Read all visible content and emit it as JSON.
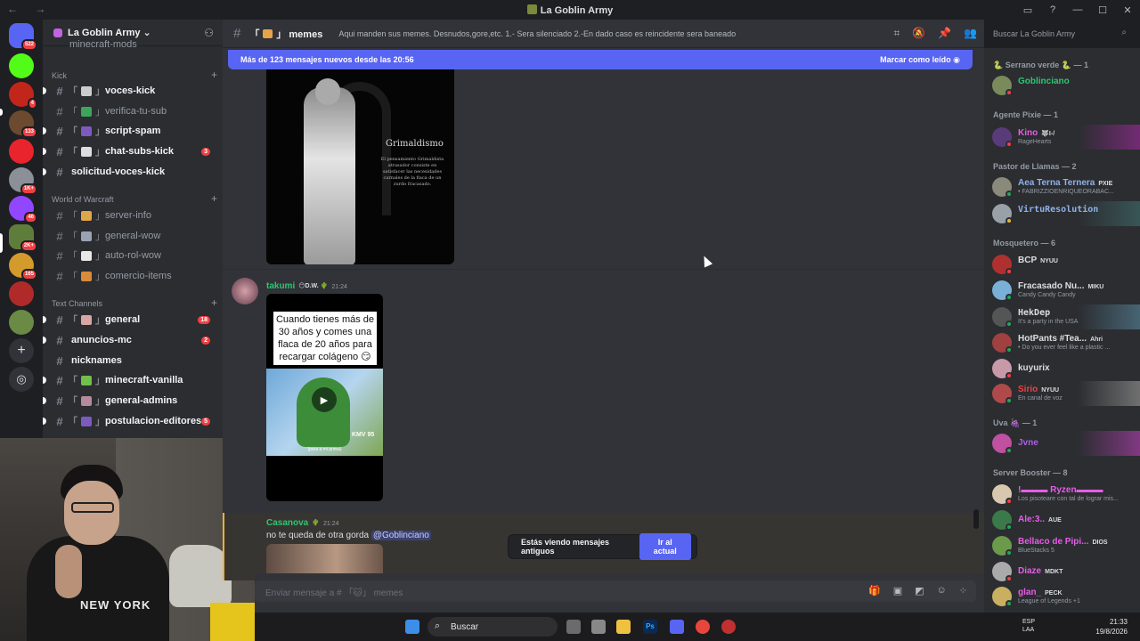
{
  "window": {
    "title": "La Goblin Army",
    "nav_arrows": "← →"
  },
  "servers": {
    "badges": [
      "522",
      "4",
      "133",
      "1K+",
      "46",
      "2K+",
      "165"
    ],
    "labels": {
      "s3": "4",
      "s4": "133",
      "s6": "1K+",
      "s7": "46",
      "s8": "2K+",
      "s9": "165",
      "s1": "522"
    }
  },
  "guild": {
    "name": "La Goblin Army ⌄"
  },
  "channels": {
    "top_partial": "minecraft-mods",
    "cat_kick": "Kick",
    "voces_kick": "voces-kick",
    "verifica": "verifica-tu-sub",
    "script_spam": "script-spam",
    "chat_subs": "chat-subs-kick",
    "chat_subs_badge": "3",
    "solicitud": "solicitud-voces-kick",
    "cat_wow": "World of Warcraft",
    "server_info": "server-info",
    "general_wow": "general-wow",
    "auto_rol": "auto-rol-wow",
    "comercio": "comercio-items",
    "cat_text": "Text Channels",
    "general": "general",
    "general_badge": "18",
    "anuncios": "anuncios-mc",
    "anuncios_badge": "2",
    "nicknames": "nicknames",
    "minecraft_vanilla": "minecraft-vanilla",
    "general_admins": "general-admins",
    "postulacion": "postulacion-editores",
    "postulacion_badge": "5"
  },
  "header": {
    "channel": "memes",
    "topic": "Aqui manden sus memes. Desnudos,gore,etc. 1.- Sera silenciado 2.-En dado caso es reincidente sera baneado",
    "search_placeholder": "Buscar La Goblin Army"
  },
  "newbar": {
    "text": "Más de 123 mensajes nuevos desde las 20:56",
    "action": "Marcar como leído"
  },
  "image1": {
    "title": "Grimaldismo",
    "text": "El pensamiento Grimaldista atrasador consiste en satisfacer las necesidades carnales de la flaca de un zurdo fracasado."
  },
  "messages": {
    "m1_author": "takumi",
    "m1_tag": "D.W.",
    "m1_time": "21:24",
    "video_caption": "Cuando tienes más de 30 años y comes una flaca de 20 años para recargar colágeno 😏",
    "video_kmv": "KMV 95",
    "video_sub": "(para a mi prima)",
    "m2_author": "Casanova",
    "m2_time": "21:24",
    "m2_text": "no te queda de otra gorda ",
    "m2_mention": "@Goblinciano"
  },
  "oldbar": {
    "text": "Estás viendo mensajes antiguos",
    "button": "Ir al actual"
  },
  "composer": {
    "placeholder": "Enviar mensaje a # 「🐱」 memes"
  },
  "members": {
    "r1": "🐍 Serrano verde 🐍 — 1",
    "u1": "Goblinciano",
    "r2": "Agente Pixie — 1",
    "u2": "Kino",
    "u2_pill": "🐺I-/",
    "u2_sub": "RageHearts",
    "r3": "Pastor de Llamas — 2",
    "u3": "Aea Terna Ternera",
    "u3_pill": "PXIE",
    "u3_sub": "• FABRIZZIOENRIQUEORABAC...",
    "u4": "VirtuResolution",
    "r4": "Mosquetero — 6",
    "u5": "BCP",
    "u5_pill": "NYUU",
    "u6": "Fracasado Nu...",
    "u6_pill": "MIKU",
    "u6_sub": "Candy Candy Candy",
    "u7": "HekDep",
    "u7_sub": "It's a party in the USA",
    "u8": "HotPants #Tea...",
    "u8_pill": "Ahri",
    "u8_sub": "• Do you ever feel like a plastic ...",
    "u9": "kuyurix",
    "u10": "Sirio",
    "u10_pill": "NYUU",
    "u10_sub": "En canal de voz",
    "r5": "Uva 🍇 — 1",
    "u11": "Jvne",
    "r6": "Server Booster — 8",
    "u12": "!▬▬▬ Ryzen▬▬▬",
    "u12_sub": "Los pisoteare con tal de lograr mis...",
    "u13": "Ale:3..",
    "u13_pill": "AUE",
    "u14": "Bellaco de Pipi...",
    "u14_pill": "DIOS",
    "u14_sub": "BlueStacks 5",
    "u15": "Diaze",
    "u15_pill": "MDKT",
    "u16": "glan_",
    "u16_pill": "PECK",
    "u16_sub": "League of Legends +1"
  },
  "taskbar": {
    "search": "Buscar",
    "lang1": "ESP",
    "lang2": "LAA",
    "time": "21:33",
    "date": "19/8/2026"
  },
  "webcam": {
    "hoodie_text": "NEW YORK"
  },
  "colors": {
    "blurple": "#5865f2",
    "green_name": "#2dc770",
    "red_badge": "#f23f43"
  }
}
